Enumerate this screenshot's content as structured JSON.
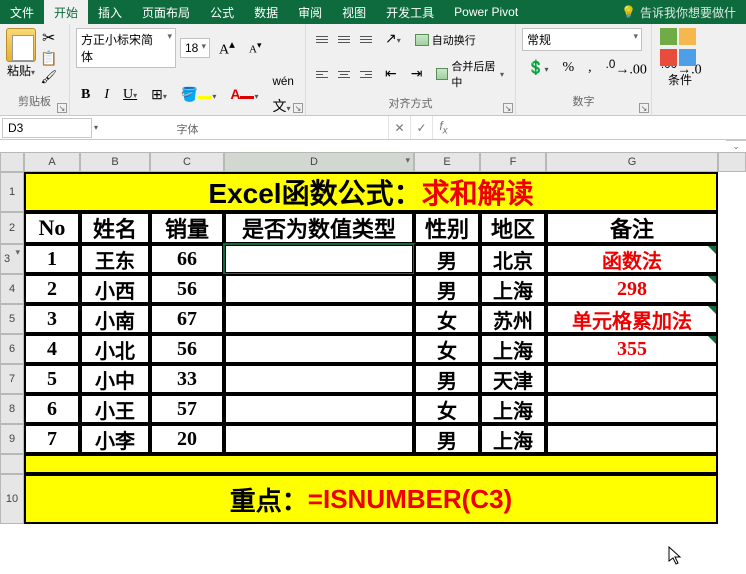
{
  "tabs": {
    "file": "文件",
    "home": "开始",
    "insert": "插入",
    "layout": "页面布局",
    "formulas": "公式",
    "data": "数据",
    "review": "审阅",
    "view": "视图",
    "dev": "开发工具",
    "pivot": "Power Pivot",
    "tell": "告诉我你想要做什"
  },
  "ribbon": {
    "clipboard": {
      "label": "剪贴板",
      "paste": "粘贴"
    },
    "font": {
      "label": "字体",
      "name": "方正小标宋简体",
      "size": "18"
    },
    "align": {
      "label": "对齐方式",
      "wrap": "自动换行",
      "merge": "合并后居中"
    },
    "number": {
      "label": "数字",
      "format": "常规"
    },
    "cond": {
      "label": "条件"
    }
  },
  "namebox": "D3",
  "formula": "",
  "cols": [
    "A",
    "B",
    "C",
    "D",
    "E",
    "F",
    "G"
  ],
  "title": {
    "part1": "Excel函数公式：",
    "part2": "求和解读"
  },
  "headers": {
    "no": "No",
    "name": "姓名",
    "sales": "销量",
    "isnum": "是否为数值类型",
    "gender": "性别",
    "region": "地区",
    "remark": "备注"
  },
  "rows": [
    {
      "no": "1",
      "name": "王东",
      "sales": "66",
      "d": "",
      "gender": "男",
      "region": "北京",
      "remark": "函数法",
      "rem_red": true
    },
    {
      "no": "2",
      "name": "小西",
      "sales": "56",
      "d": "",
      "gender": "男",
      "region": "上海",
      "remark": "298",
      "rem_red": true
    },
    {
      "no": "3",
      "name": "小南",
      "sales": "67",
      "d": "",
      "gender": "女",
      "region": "苏州",
      "remark": "单元格累加法",
      "rem_red": true
    },
    {
      "no": "4",
      "name": "小北",
      "sales": "56",
      "d": "",
      "gender": "女",
      "region": "上海",
      "remark": "355",
      "rem_red": true
    },
    {
      "no": "5",
      "name": "小中",
      "sales": "33",
      "d": "",
      "gender": "男",
      "region": "天津",
      "remark": "",
      "rem_red": false
    },
    {
      "no": "6",
      "name": "小王",
      "sales": "57",
      "d": "",
      "gender": "女",
      "region": "上海",
      "remark": "",
      "rem_red": false
    },
    {
      "no": "7",
      "name": "小李",
      "sales": "20",
      "d": "",
      "gender": "男",
      "region": "上海",
      "remark": "",
      "rem_red": false
    }
  ],
  "footer": {
    "label": "重点：",
    "formula": "=ISNUMBER(C3)"
  }
}
